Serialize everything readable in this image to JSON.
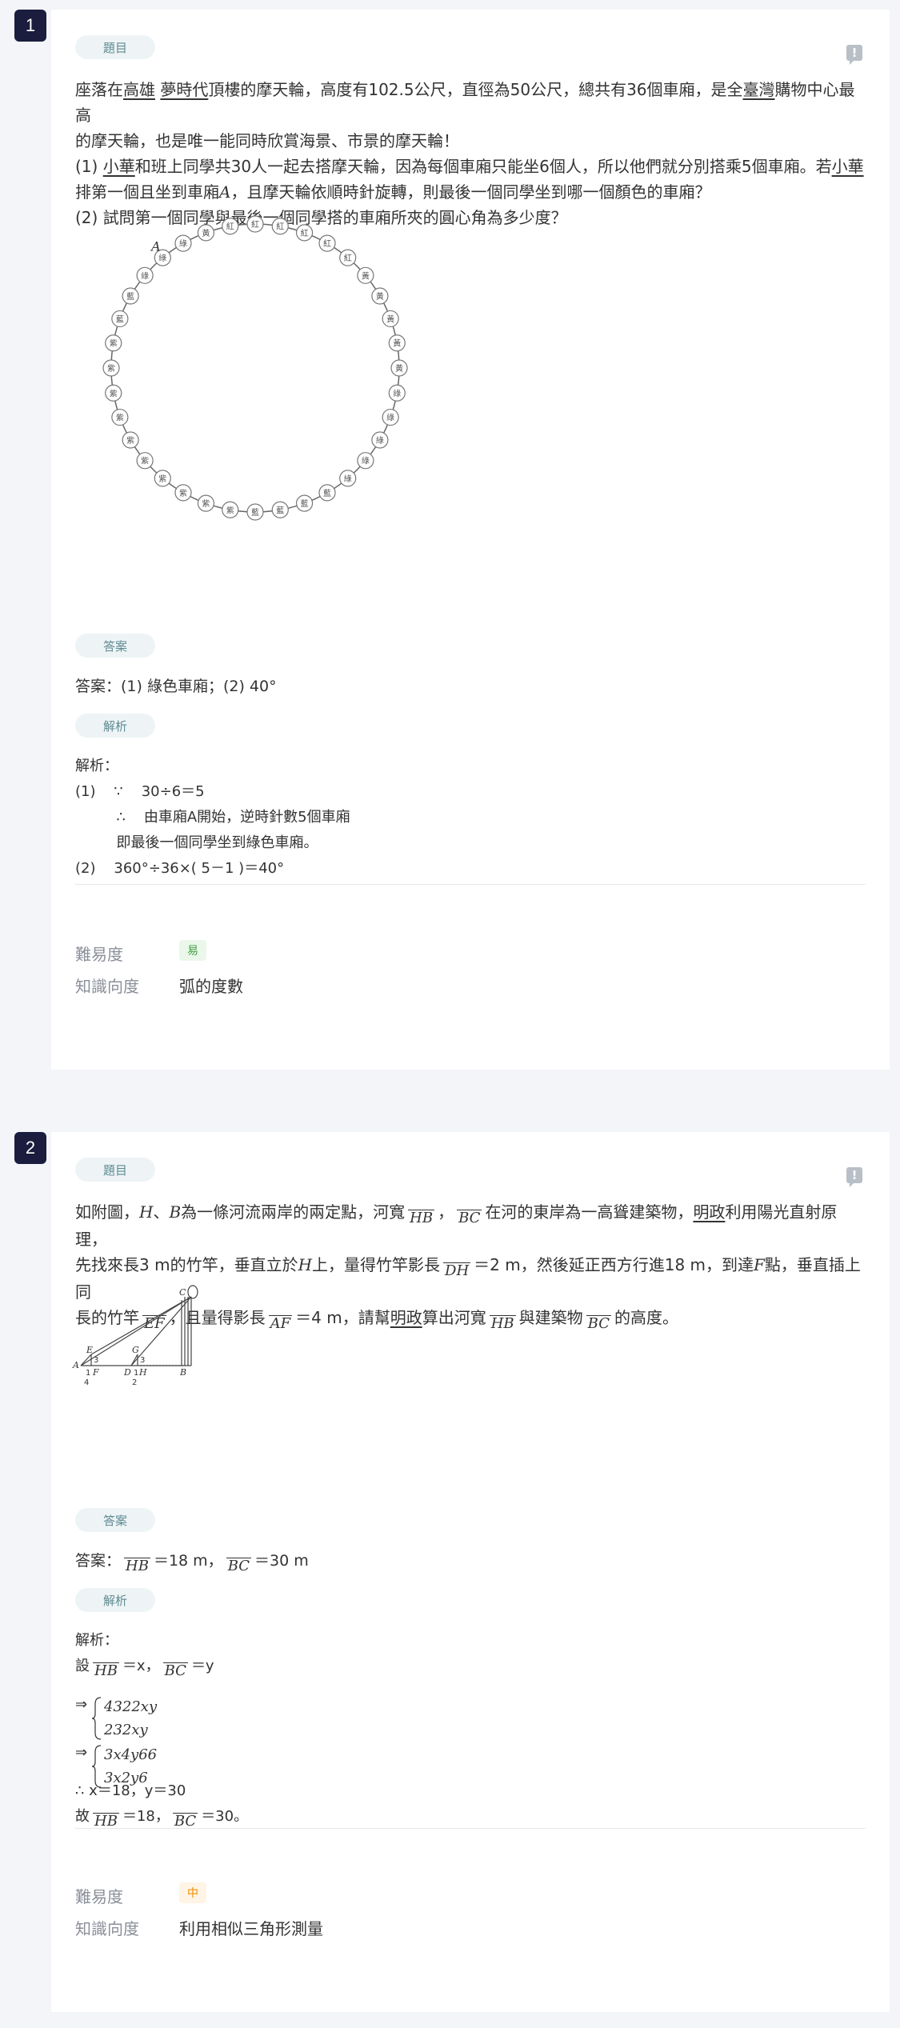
{
  "labels": {
    "question_tag": "題目",
    "answer_tag": "答案",
    "analysis_tag": "解析",
    "difficulty_label": "難易度",
    "knowledge_label": "知識向度",
    "report_icon": "!"
  },
  "colors": {
    "number_badge": "#1a1d3d",
    "tag_bg": "#eef4f5",
    "tag_text": "#5e8a93",
    "easy": "#43a047",
    "medium": "#f08c00"
  },
  "q1": {
    "number": "1",
    "text_line1_a": "座落在",
    "text_line1_u1": "高雄",
    "text_line1_b": " ",
    "text_line1_u2": "夢時代",
    "text_line1_c": "頂樓的摩天輪，高度有102.5公尺，直徑為50公尺，總共有36個車廂，是全",
    "text_line1_u3": "臺灣",
    "text_line1_d": "購物中心最高",
    "text_line2": "的摩天輪，也是唯一能同時欣賞海景、市景的摩天輪！",
    "text_line3_a": "(1) ",
    "text_line3_u1": "小華",
    "text_line3_b": "和班上同學共30人一起去搭摩天輪，因為每個車廂只能坐6個人，所以他們就分別搭乘5個車廂。若",
    "text_line3_u2": "小華",
    "text_line4_a": "排第一個且坐到車廂",
    "text_line4_it": "A",
    "text_line4_b": "，且摩天輪依順時針旋轉，則最後一個同學坐到哪一個顏色的車廂？",
    "text_line5": "(2) 試問第一個同學與最後一個同學搭的車廂所夾的圓心角為多少度？",
    "cabins": [
      "紅",
      "紅",
      "紅",
      "紅",
      "紅",
      "黃",
      "黃",
      "黃",
      "黃",
      "黃",
      "綠",
      "綠",
      "綠",
      "綠",
      "綠",
      "藍",
      "藍",
      "藍",
      "藍",
      "紫",
      "紫",
      "紫",
      "紫",
      "紫",
      "紫",
      "紫",
      "紫",
      "紫",
      "紫",
      "藍",
      "藍",
      "綠",
      "綠",
      "綠",
      "黃",
      "紅"
    ],
    "cabin_label_a": "A",
    "answer": "答案：(1) 綠色車廂；(2) 40°",
    "analysis_title": "解析：",
    "analysis_rows": [
      "(1)    ∵    30÷6＝5",
      "         ∴    由車廂A開始，逆時針數5個車廂",
      "         即最後一個同學坐到綠色車廂。",
      "(2)    360°÷36×( 5－1 )＝40°"
    ],
    "difficulty": "易",
    "knowledge": "弧的度數"
  },
  "q2": {
    "number": "2",
    "l1_a": "如附圖，",
    "l1_it1": "H",
    "l1_b": "、",
    "l1_it2": "B",
    "l1_c": "為一條河流兩岸的兩定點，河寬",
    "ov_hb": "HB",
    "l1_d": "，",
    "ov_bc": "BC",
    "l1_e": "在河的東岸為一高聳建築物，",
    "l1_u1": "明政",
    "l1_f": "利用陽光直射原理，",
    "l2_a": "先找來長3 m的竹竿，垂直立於",
    "l2_it": "H",
    "l2_b": "上，量得竹竿影長",
    "ov_dh": "DH",
    "l2_c": "＝2 m，然後延正西方行進18 m，到達",
    "l2_it2": "F",
    "l2_d": "點，垂直插上同",
    "l3_a": "長的竹竿",
    "ov_ef": "EF",
    "l3_b": "，且量得影長",
    "ov_af": "AF",
    "l3_c": "＝4 m，請幫",
    "l3_u1": "明政",
    "l3_d": "算出河寬",
    "l3_e": "與建築物",
    "l3_f": "的高度。",
    "fig_labels": {
      "a": "A",
      "e": "E",
      "f": "F",
      "g": "G",
      "d": "D",
      "h": "H",
      "b": "B",
      "c": "C",
      "n3a": "3",
      "n3b": "3",
      "n1a": "1",
      "n1b": "1",
      "n4": "4",
      "n2": "2"
    },
    "answer_prefix": "答案：",
    "answer_hb": "＝18 m，",
    "answer_bc": "＝30 m",
    "analysis_title": "解析：",
    "set_a": "設",
    "set_x": "＝x，",
    "set_y": "＝y",
    "arrow": "⇒",
    "sys1_a": "4322xy",
    "sys1_b": "232xy",
    "sys2_a": "3x4y66",
    "sys2_b": "3x2y6",
    "result": "∴ x＝18，y＝30",
    "final_a": "故",
    "final_b": "＝18，",
    "final_c": "＝30。",
    "difficulty": "中",
    "knowledge": "利用相似三角形測量"
  }
}
